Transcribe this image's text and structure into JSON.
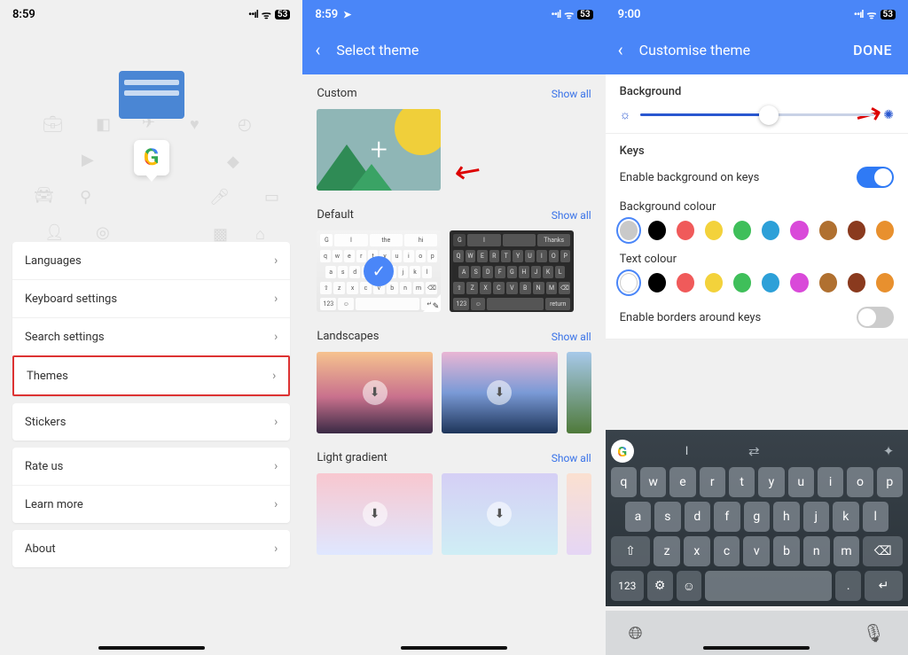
{
  "pane1": {
    "time": "8:59",
    "battery": "53",
    "menu_main": [
      "Languages",
      "Keyboard settings",
      "Search settings",
      "Themes"
    ],
    "menu_stickers": [
      "Stickers"
    ],
    "menu_misc": [
      "Rate us",
      "Learn more"
    ],
    "menu_about": [
      "About"
    ],
    "highlight_index": 3
  },
  "pane2": {
    "time": "8:59",
    "battery": "53",
    "title": "Select theme",
    "sections": {
      "custom": "Custom",
      "default": "Default",
      "landscapes": "Landscapes",
      "light_gradient": "Light gradient"
    },
    "show_all": "Show all",
    "default_light_top_row": [
      "q",
      "w",
      "e",
      "r",
      "t",
      "y",
      "u",
      "i",
      "o",
      "p"
    ],
    "default_dark_top_row": [
      "Q",
      "W",
      "E",
      "R",
      "T",
      "Y",
      "U",
      "I",
      "O",
      "P"
    ],
    "kb_sugg_light": [
      "I",
      "the",
      "hi"
    ],
    "kb_sugg_dark": [
      "I",
      "",
      "Thanks"
    ]
  },
  "pane3": {
    "time": "9:00",
    "battery": "53",
    "title": "Customise theme",
    "done": "DONE",
    "background_label": "Background",
    "keys_label": "Keys",
    "enable_bg_keys": "Enable background on keys",
    "bg_colour_label": "Background colour",
    "text_colour_label": "Text colour",
    "borders_label": "Enable borders around keys",
    "bg_colours": [
      "#c9c9c9",
      "#000000",
      "#f05a5a",
      "#f3d23b",
      "#3fbf5a",
      "#2da0d8",
      "#d94ad9",
      "#b07030",
      "#8a3a1e",
      "#e8902e"
    ],
    "text_colours": [
      "#ffffff",
      "#000000",
      "#f05a5a",
      "#f3d23b",
      "#3fbf5a",
      "#2da0d8",
      "#d94ad9",
      "#b07030",
      "#8a3a1e",
      "#e8902e"
    ],
    "bg_sel": 0,
    "text_sel": 0,
    "kb": {
      "sugg_text": "I",
      "r1": [
        "q",
        "w",
        "e",
        "r",
        "t",
        "y",
        "u",
        "i",
        "o",
        "p"
      ],
      "r2": [
        "a",
        "s",
        "d",
        "f",
        "g",
        "h",
        "j",
        "k",
        "l"
      ],
      "r3_mid": [
        "z",
        "x",
        "c",
        "v",
        "b",
        "n",
        "m"
      ],
      "num_label": "123",
      "return_label": "↵"
    }
  }
}
